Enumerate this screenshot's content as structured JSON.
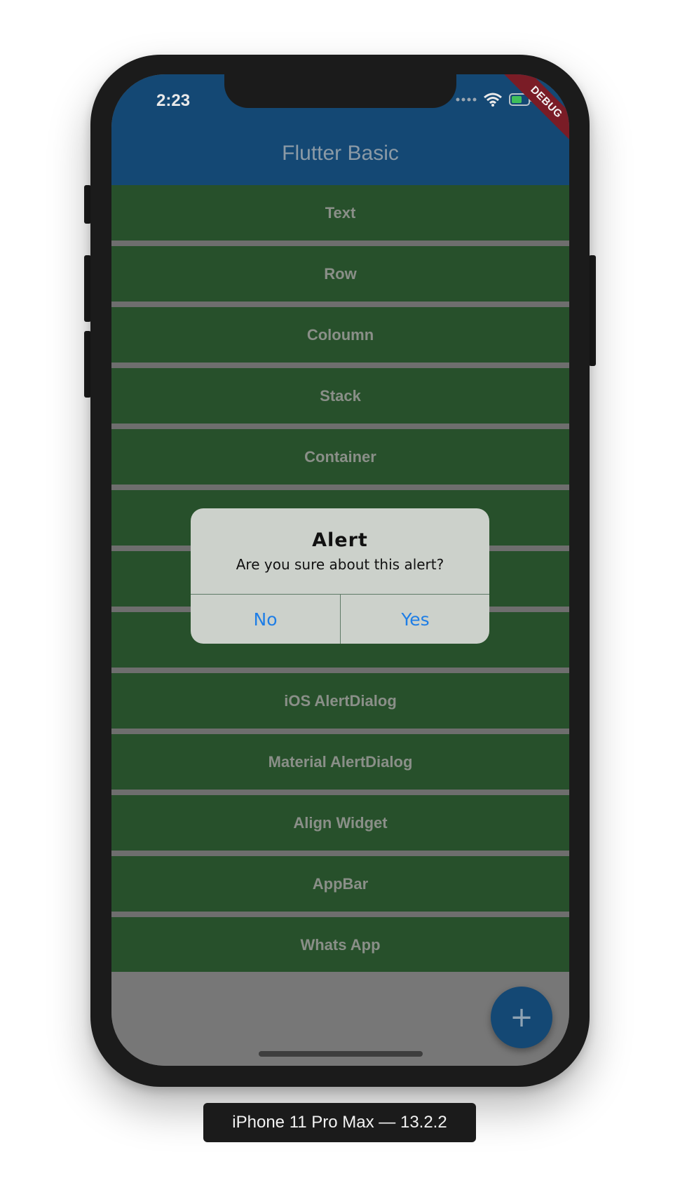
{
  "status_bar": {
    "time": "2:23"
  },
  "app_bar": {
    "title": "Flutter Basic",
    "debug_banner": "DEBUG",
    "color": "#144874"
  },
  "list": {
    "item_color": "#27502b",
    "items": [
      {
        "label": "Text"
      },
      {
        "label": "Row"
      },
      {
        "label": "Coloumn"
      },
      {
        "label": "Stack"
      },
      {
        "label": "Container"
      },
      {
        "label": ""
      },
      {
        "label": ""
      },
      {
        "label": ""
      },
      {
        "label": "iOS AlertDialog"
      },
      {
        "label": "Material AlertDialog"
      },
      {
        "label": "Align Widget"
      },
      {
        "label": "AppBar"
      },
      {
        "label": "Whats App"
      }
    ]
  },
  "dialog": {
    "title": "Alert",
    "message": "Are you sure about this alert?",
    "no_label": "No",
    "yes_label": "Yes",
    "button_color": "#1f7ee6"
  },
  "fab": {
    "icon": "plus-icon",
    "glyph": "+"
  },
  "device_label": "iPhone 11 Pro Max — 13.2.2"
}
